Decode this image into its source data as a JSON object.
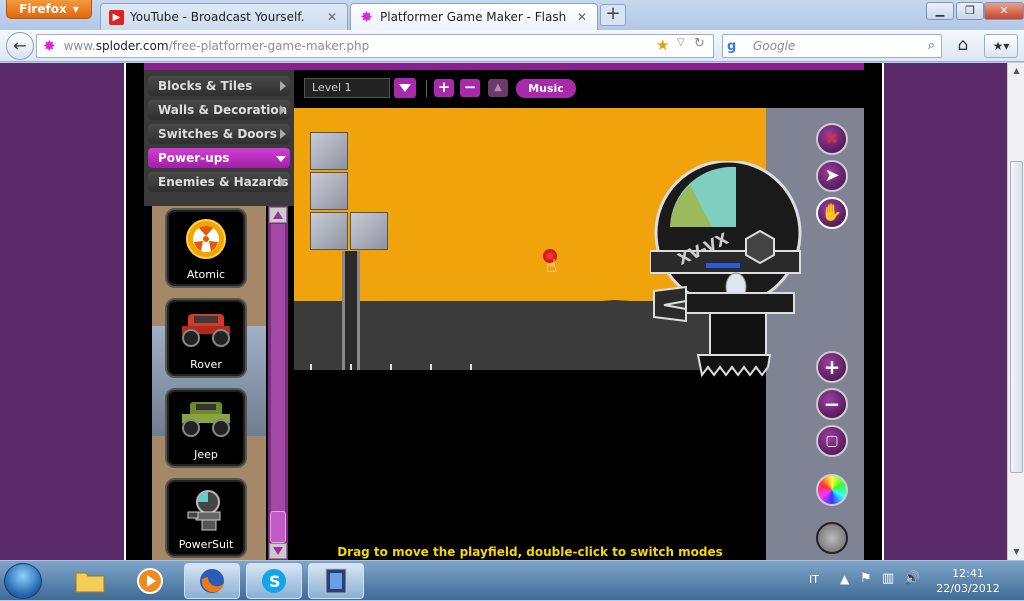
{
  "browser": {
    "app_button": "Firefox",
    "tabs": [
      {
        "label": "YouTube - Broadcast Yourself.",
        "icon": "youtube-icon"
      },
      {
        "label": "Platformer Game Maker - Flash Game...",
        "icon": "sploder-icon"
      }
    ],
    "url_domain": "www.",
    "url_host": "sploder.com",
    "url_path": "/free-platformer-game-maker.php",
    "search_placeholder": "Google"
  },
  "editor": {
    "categories": [
      {
        "label": "Blocks & Tiles"
      },
      {
        "label": "Walls & Decoration"
      },
      {
        "label": "Switches & Doors"
      },
      {
        "label": "Power-ups"
      },
      {
        "label": "Enemies & Hazards"
      }
    ],
    "active_category": "Power-ups",
    "items": [
      {
        "label": "Atomic"
      },
      {
        "label": "Rover"
      },
      {
        "label": "Jeep"
      },
      {
        "label": "PowerSuit"
      }
    ],
    "level_select": "Level 1",
    "music_label": "Music",
    "robot_label": "XV-VX",
    "hint": "Drag to move the playfield, double-click to switch modes",
    "colors": {
      "accent": "#a82aab",
      "sky": "#f0a30a",
      "hint": "#f4d800"
    }
  },
  "taskbar": {
    "language": "IT",
    "time": "12:41",
    "date": "22/03/2012"
  }
}
